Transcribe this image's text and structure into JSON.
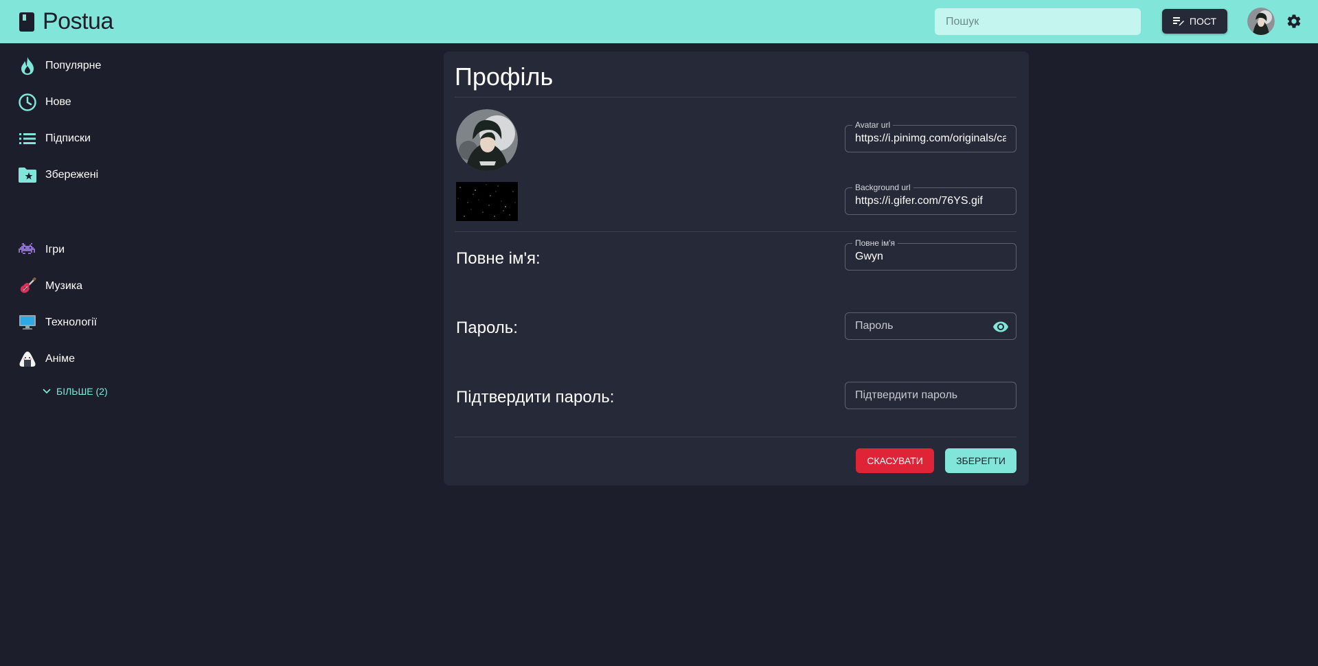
{
  "header": {
    "app_name": "Postua",
    "search_placeholder": "Пошук",
    "post_button": "ПОСТ",
    "colors": {
      "accent": "#81e6d9",
      "background": "#1c1f2b",
      "card": "#262a38",
      "danger": "#e02438"
    }
  },
  "sidebar": {
    "items": [
      {
        "label": "Популярне",
        "icon": "flame-icon"
      },
      {
        "label": "Нове",
        "icon": "clock-icon"
      },
      {
        "label": "Підписки",
        "icon": "list-icon"
      },
      {
        "label": "Збережені",
        "icon": "folder-star-icon"
      }
    ],
    "categories": [
      {
        "label": "Ігри",
        "icon": "space-invader-icon"
      },
      {
        "label": "Музика",
        "icon": "guitar-icon"
      },
      {
        "label": "Технології",
        "icon": "desktop-icon"
      },
      {
        "label": "Аніме",
        "icon": "onigiri-icon"
      }
    ],
    "more_label": "БІЛЬШЕ (2)"
  },
  "profile": {
    "title": "Профіль",
    "avatar_url": {
      "legend": "Avatar url",
      "value": "https://i.pinimg.com/originals/ca"
    },
    "background_url": {
      "legend": "Background url",
      "value": "https://i.gifer.com/76YS.gif"
    },
    "full_name": {
      "label": "Повне ім'я:",
      "legend": "Повне ім'я",
      "value": "Gwyn"
    },
    "password": {
      "label": "Пароль:",
      "placeholder": "Пароль"
    },
    "confirm_password": {
      "label": "Підтвердити пароль:",
      "placeholder": "Підтвердити пароль"
    },
    "cancel_button": "СКАСУВАТИ",
    "save_button": "ЗБЕРЕГТИ"
  }
}
